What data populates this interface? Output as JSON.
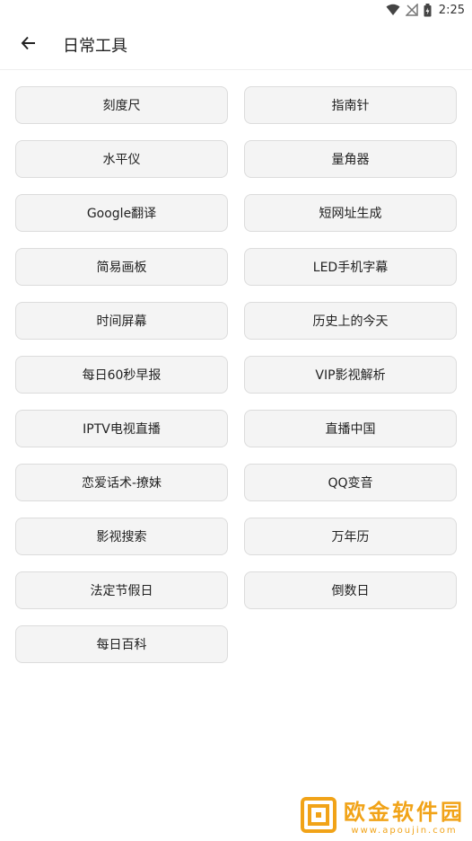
{
  "status_bar": {
    "time": "2:25",
    "icons": [
      "wifi-icon",
      "no-signal-icon",
      "battery-icon"
    ]
  },
  "app_bar": {
    "back_icon": "arrow-left-icon",
    "title": "日常工具"
  },
  "tools": [
    "刻度尺",
    "指南针",
    "水平仪",
    "量角器",
    "Google翻译",
    "短网址生成",
    "简易画板",
    "LED手机字幕",
    "时间屏幕",
    "历史上的今天",
    "每日60秒早报",
    "VIP影视解析",
    "IPTV电视直播",
    "直播中国",
    "恋爱话术-撩妹",
    "QQ变音",
    "影视搜索",
    "万年历",
    "法定节假日",
    "倒数日",
    "每日百科"
  ],
  "watermark": {
    "title": "欧金软件园",
    "subtitle": "www.apoujin.com"
  },
  "colors": {
    "button_bg": "#f4f4f4",
    "button_border": "#dcdcdc",
    "watermark": "#f1a318"
  }
}
